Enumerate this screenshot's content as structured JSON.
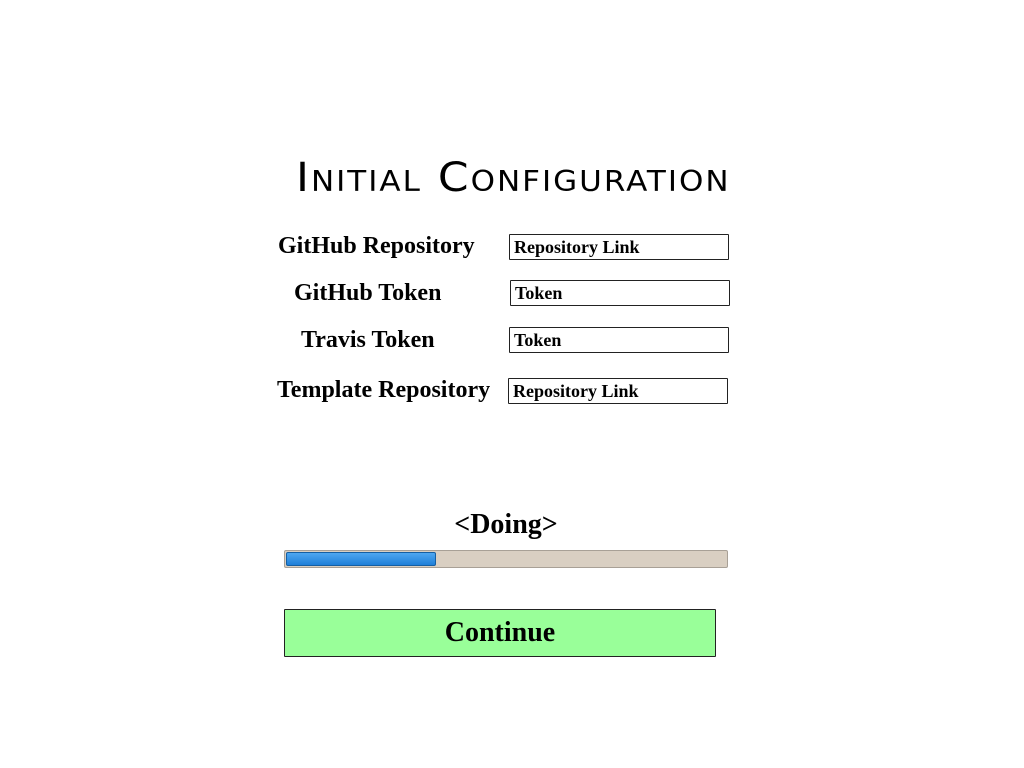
{
  "title": "Initial Configuration",
  "form": {
    "fields": [
      {
        "label": "GitHub Repository",
        "placeholder": "Repository Link"
      },
      {
        "label": "GitHub Token",
        "placeholder": "Token"
      },
      {
        "label": "Travis Token",
        "placeholder": "Token"
      },
      {
        "label": "Template Repository",
        "placeholder": "Repository Link"
      }
    ]
  },
  "status": {
    "text": "<Doing>",
    "progress": 0.34,
    "progress_color": "#1f7fd8",
    "track_color": "#d9cfc2"
  },
  "continue_button": {
    "label": "Continue",
    "color": "#99ff99"
  }
}
